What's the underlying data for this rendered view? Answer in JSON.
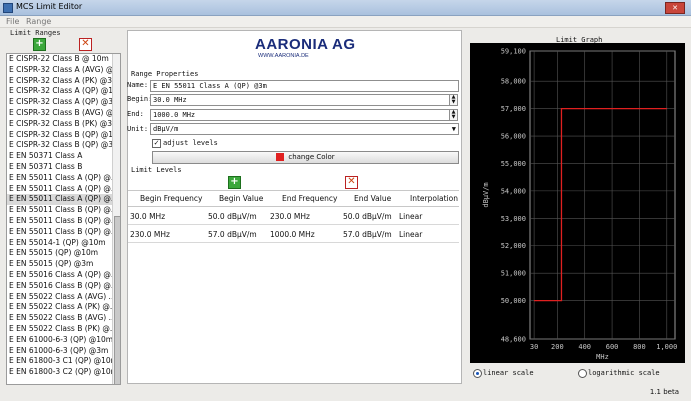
{
  "window": {
    "title": "MCS Limit Editor"
  },
  "menu": {
    "file": "File",
    "range": "Range"
  },
  "limit_ranges": {
    "label": "Limit Ranges",
    "items": [
      "E CISPR-22 Class B @ 10m",
      "E CISPR-32 Class A (AVG) @...",
      "E CISPR-32 Class A (PK) @3...",
      "E CISPR-32 Class A (QP) @1...",
      "E CISPR-32 Class A (QP) @3m",
      "E CISPR-32 Class B (AVG) @...",
      "E CISPR-32 Class B (PK) @3...",
      "E CISPR-32 Class B (QP) @1...",
      "E CISPR-32 Class B (QP) @3m",
      "E EN 50371 Class A",
      "E EN 50371 Class B",
      "E EN 55011 Class A (QP) @...",
      "E EN 55011 Class A (QP) @...",
      "E EN 55011 Class A (QP) @...",
      "E EN 55011 Class B (QP) @...",
      "E EN 55011 Class B (QP) @...",
      "E EN 55011 Class B (QP) @...",
      "E EN 55014-1 (QP) @10m",
      "E EN 55015 (QP) @10m",
      "E EN 55015 (QP) @3m",
      "E EN 55016 Class A (QP) @...",
      "E EN 55016 Class B (QP) @...",
      "E EN 55022 Class A (AVG) ...",
      "E EN 55022 Class A (PK) @...",
      "E EN 55022 Class B (AVG) ...",
      "E EN 55022 Class B (PK) @...",
      "E EN 61000-6-3 (QP) @10m",
      "E EN 61000-6-3 (QP) @3m",
      "E EN 61800-3 C1 (QP) @10m",
      "E EN 61800-3 C2 (QP) @10m"
    ]
  },
  "brand": {
    "name": "AARONIA AG",
    "url": "WWW.AARONIA.DE"
  },
  "range_properties": {
    "label": "Range Properties",
    "name_label": "Name:",
    "name_value": "E EN 55011 Class A (QP) @3m",
    "begin_label": "Begin:",
    "begin_value": "30.0 MHz",
    "end_label": "End:",
    "end_value": "1000.0 MHz",
    "unit_label": "Unit:",
    "unit_value": "dBµV/m",
    "adjust_label": "adjust levels",
    "change_color_label": "change Color",
    "color": "#e02020"
  },
  "limit_levels": {
    "label": "Limit Levels",
    "columns": [
      "Begin Frequency",
      "Begin Value",
      "End Frequency",
      "End Value",
      "Interpolation"
    ],
    "rows": [
      [
        "30.0 MHz",
        "50.0 dBµV/m",
        "230.0 MHz",
        "50.0 dBµV/m",
        "Linear"
      ],
      [
        "230.0 MHz",
        "57.0 dBµV/m",
        "1000.0 MHz",
        "57.0 dBµV/m",
        "Linear"
      ]
    ]
  },
  "graph": {
    "title": "Limit Graph",
    "ylabel": "dBµV/m",
    "xlabel": "MHz",
    "xmin": 0,
    "xmax": 1060,
    "ymin": 48600,
    "ymax": 59100,
    "y_ticks": [
      48600,
      50000,
      51000,
      52000,
      53000,
      54000,
      55000,
      56000,
      57000,
      58000,
      59100
    ],
    "y_tick_labels": [
      "48,600",
      "50,000",
      "51,000",
      "52,000",
      "53,000",
      "54,000",
      "55,000",
      "56,000",
      "57,000",
      "58,000",
      "59,100"
    ],
    "x_ticks": [
      30,
      200,
      400,
      600,
      800,
      1000
    ],
    "x_tick_labels": [
      "30",
      "200",
      "400",
      "600",
      "800",
      "1,000"
    ],
    "line_color": "#e02020"
  },
  "chart_data": {
    "type": "line",
    "series": [
      {
        "values": [
          {
            "x": 30,
            "y": 50000
          },
          {
            "x": 230,
            "y": 50000
          },
          {
            "x": 230,
            "y": 57000
          },
          {
            "x": 1000,
            "y": 57000
          }
        ]
      }
    ],
    "xlabel": "MHz",
    "ylabel": "dBµV/m",
    "xlim": [
      0,
      1060
    ],
    "ylim": [
      48600,
      59100
    ]
  },
  "scale": {
    "linear": "linear scale",
    "log": "logarithmic scale"
  },
  "version": "1.1 beta"
}
